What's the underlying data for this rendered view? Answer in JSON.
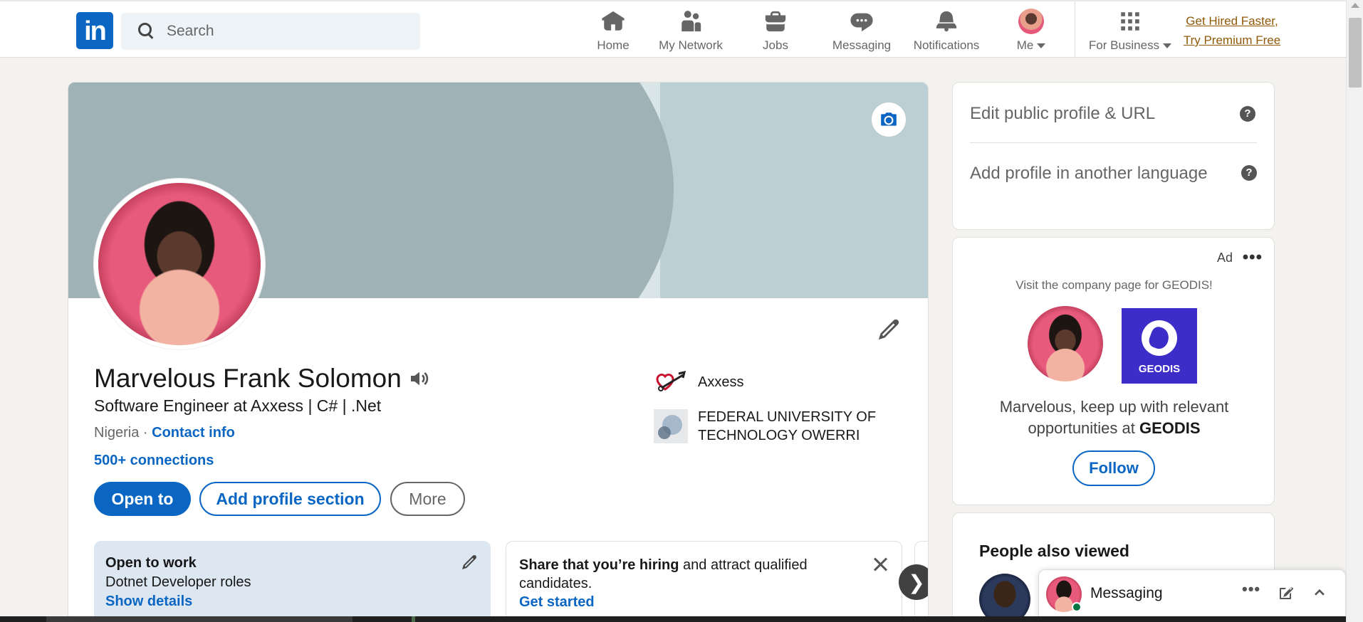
{
  "nav": {
    "logo_text": "in",
    "search_placeholder": "Search",
    "items": [
      {
        "label": "Home",
        "icon": "home-icon"
      },
      {
        "label": "My Network",
        "icon": "network-icon"
      },
      {
        "label": "Jobs",
        "icon": "briefcase-icon"
      },
      {
        "label": "Messaging",
        "icon": "chat-icon"
      },
      {
        "label": "Notifications",
        "icon": "bell-icon"
      },
      {
        "label": "Me",
        "icon": "avatar"
      }
    ],
    "business_label": "For Business",
    "premium_line1": "Get Hired Faster,",
    "premium_line2": "Try Premium Free"
  },
  "profile": {
    "name": "Marvelous Frank Solomon",
    "headline": "Software Engineer at Axxess | C# | .Net",
    "location": "Nigeria",
    "separator": " · ",
    "contact_info": "Contact info",
    "connections": "500+ connections",
    "buttons": {
      "open_to": "Open to",
      "add_section": "Add profile section",
      "more": "More"
    },
    "experience": [
      {
        "name": "Axxess"
      },
      {
        "name": "FEDERAL UNIVERSITY OF TECHNOLOGY OWERRI"
      }
    ],
    "open_to_work": {
      "title": "Open to work",
      "roles": "Dotnet Developer roles",
      "link": "Show details"
    },
    "hiring": {
      "bold": "Share that you’re hiring",
      "rest": " and attract qualified candidates.",
      "link": "Get started"
    },
    "carousel_next": "❯"
  },
  "sidebar": {
    "edit_public_profile": "Edit public profile & URL",
    "add_language_profile": "Add profile in another language",
    "help_glyph": "?",
    "ad": {
      "label": "Ad",
      "menu": "•••",
      "visit": "Visit the company page for GEODIS!",
      "company_logo_text": "GEODIS",
      "message_prefix": "Marvelous, keep up with relevant opportunities at ",
      "company": "GEODIS",
      "follow": "Follow"
    },
    "people_also_viewed": "People also viewed"
  },
  "messaging": {
    "label": "Messaging",
    "menu": "•••"
  },
  "colors": {
    "linkedin_blue": "#0a66c2",
    "premium_gold": "#915907",
    "geodis_purple": "#3d2dc8",
    "online_green": "#057642"
  }
}
